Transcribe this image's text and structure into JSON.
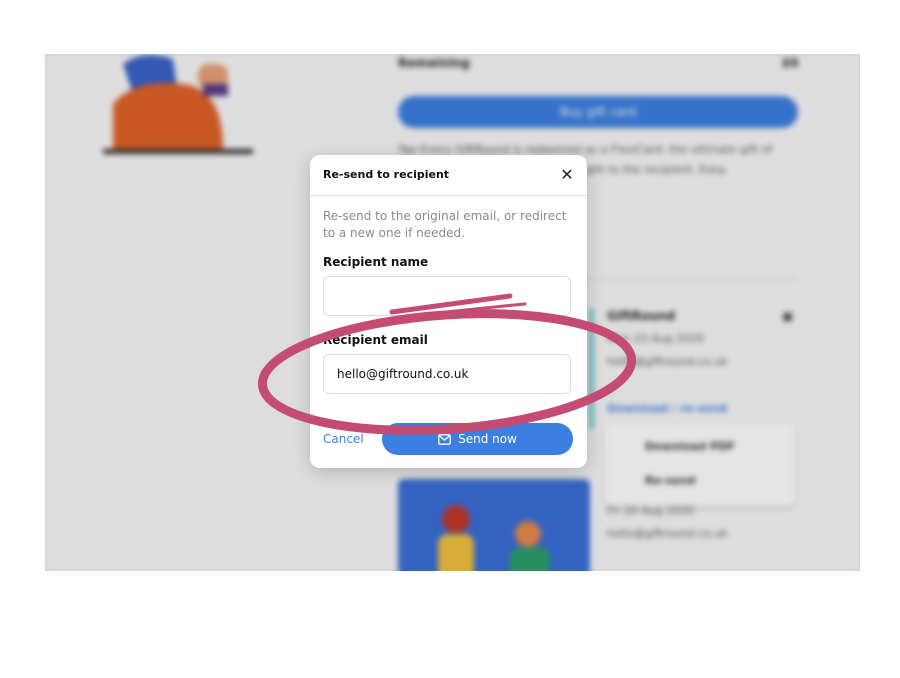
{
  "background": {
    "remaining_label": "Remaining",
    "remaining_value": "£6",
    "buy_button": "Buy gift card",
    "paragraph": "Tap Every GiftRound is redeemed as a FlexiCard, the ultimate gift of choice — spend it yourself or straight to the recipient. Easy.",
    "card_title": "GiftRound",
    "card_date": "Mon 23 Aug 2020",
    "card_email": "hello@giftround.co.uk",
    "download_resend": "Download / re-send",
    "menu_download": "Download PDF",
    "menu_resend": "Re-send",
    "second_date": "Fri 20 Aug 2020",
    "second_email": "hello@giftround.co.uk"
  },
  "modal": {
    "title": "Re-send to recipient",
    "description": "Re-send to the original email, or redirect to a new one if needed.",
    "name_label": "Recipient name",
    "name_value": "",
    "email_label": "Recipient email",
    "email_value": "hello@giftround.co.uk",
    "cancel_label": "Cancel",
    "send_label": "Send now"
  },
  "colors": {
    "accent": "#3d7fe0",
    "annotation": "#c44b72"
  }
}
